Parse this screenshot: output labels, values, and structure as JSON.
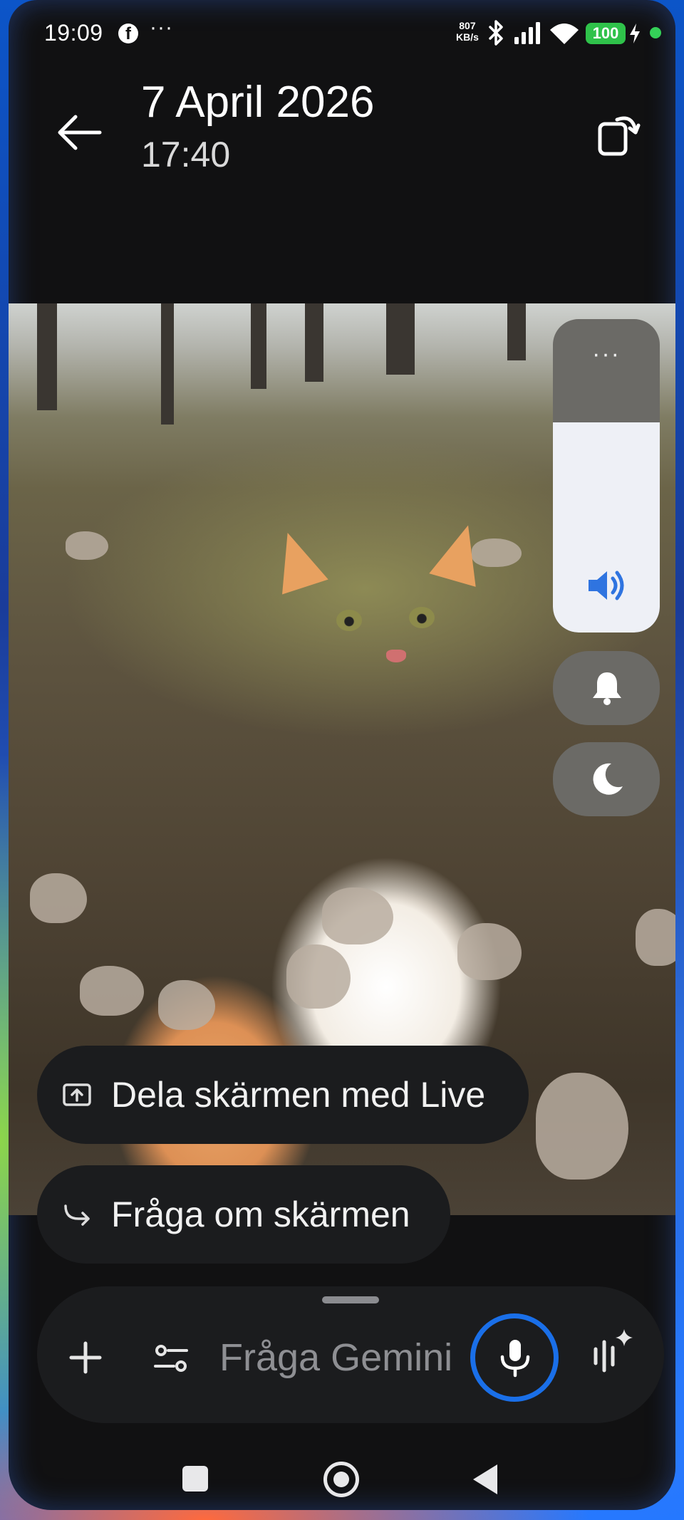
{
  "status_bar": {
    "time": "19:09",
    "notification_app": "f",
    "more": "···",
    "net_speed_value": "807",
    "net_speed_unit": "KB/s",
    "battery": "100",
    "icons": [
      "facebook-icon",
      "bluetooth-icon",
      "signal-icon",
      "wifi-icon",
      "battery-icon",
      "charging-icon"
    ]
  },
  "header": {
    "title": "7 April 2026",
    "subtitle": "17:40",
    "icons": [
      "arrow-back-icon",
      "rotate-screen-icon"
    ]
  },
  "volume_panel": {
    "more": "···",
    "level": 0.67,
    "icons": [
      "speaker-icon",
      "bell-icon",
      "moon-icon"
    ]
  },
  "suggestions": [
    {
      "label": "Dela skärmen med Live",
      "icon": "screen-share-icon"
    },
    {
      "label": "Fråga om skärmen",
      "icon": "forward-arrow-icon"
    }
  ],
  "input_bar": {
    "placeholder": "Fråga Gemini",
    "icons": [
      "plus-icon",
      "tools-icon",
      "microphone-icon",
      "gemini-live-icon"
    ]
  },
  "nav_bar": {
    "icons": [
      "recents-icon",
      "home-icon",
      "back-icon"
    ]
  },
  "colors": {
    "accent": "#1a6fe8",
    "battery": "#2fc24a",
    "surface": "#1b1c1e"
  }
}
